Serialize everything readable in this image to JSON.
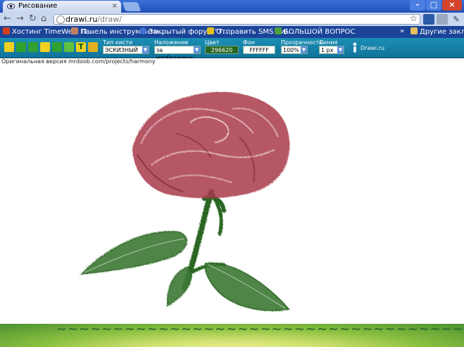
{
  "browser": {
    "tab_title": "Рисование",
    "url_host": "drawi.ru",
    "url_path": "/draw/"
  },
  "bookmarks": {
    "items": [
      "Хостинг TimeWeb: П...",
      "Панель инструменто...",
      "Закрытый форум \"Т...",
      "Отправить SMS Би/...",
      "БОЛЬШОЙ ВОПРОС"
    ],
    "overflow": "»",
    "other": "Другие закладки"
  },
  "toolbar": {
    "brush_label": "Тип кисти",
    "brush_value": "ЭСКИЗНЫЙ",
    "overlay_label": "Наложение",
    "overlay_value": "за изображени",
    "color_label": "Цвет",
    "color_value": "296620",
    "bg_label": "Фон",
    "bg_value": "FFFFFF",
    "opacity_label": "Прозрачность",
    "opacity_value": "100%",
    "line_label": "Линия",
    "line_value": "1 px",
    "site_link": "Drawi.ru"
  },
  "page": {
    "credit": "Оригинальная версия mrdoob.com/projects/harmony"
  },
  "colors": {
    "petal": "#a83a4a",
    "stem": "#296620",
    "toolbar": "#1b8fb5"
  }
}
